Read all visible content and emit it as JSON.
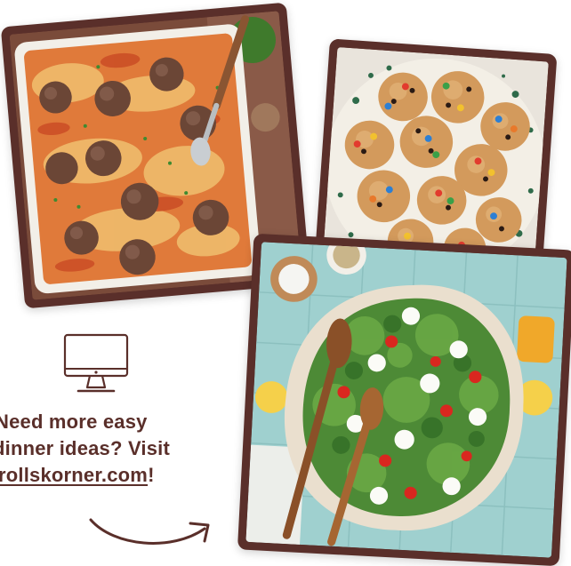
{
  "cta": {
    "line1": "Need more easy",
    "line2": "dinner ideas? Visit",
    "link": "rollskorner.com",
    "punct": "!"
  },
  "icons": {
    "monitor": "computer-monitor-icon",
    "arrow": "curved-arrow-icon"
  },
  "colors": {
    "brand": "#5a2f2a",
    "background": "#ffffff",
    "tile_blue": "#9fd0cf",
    "sauce": "#d8582b"
  }
}
